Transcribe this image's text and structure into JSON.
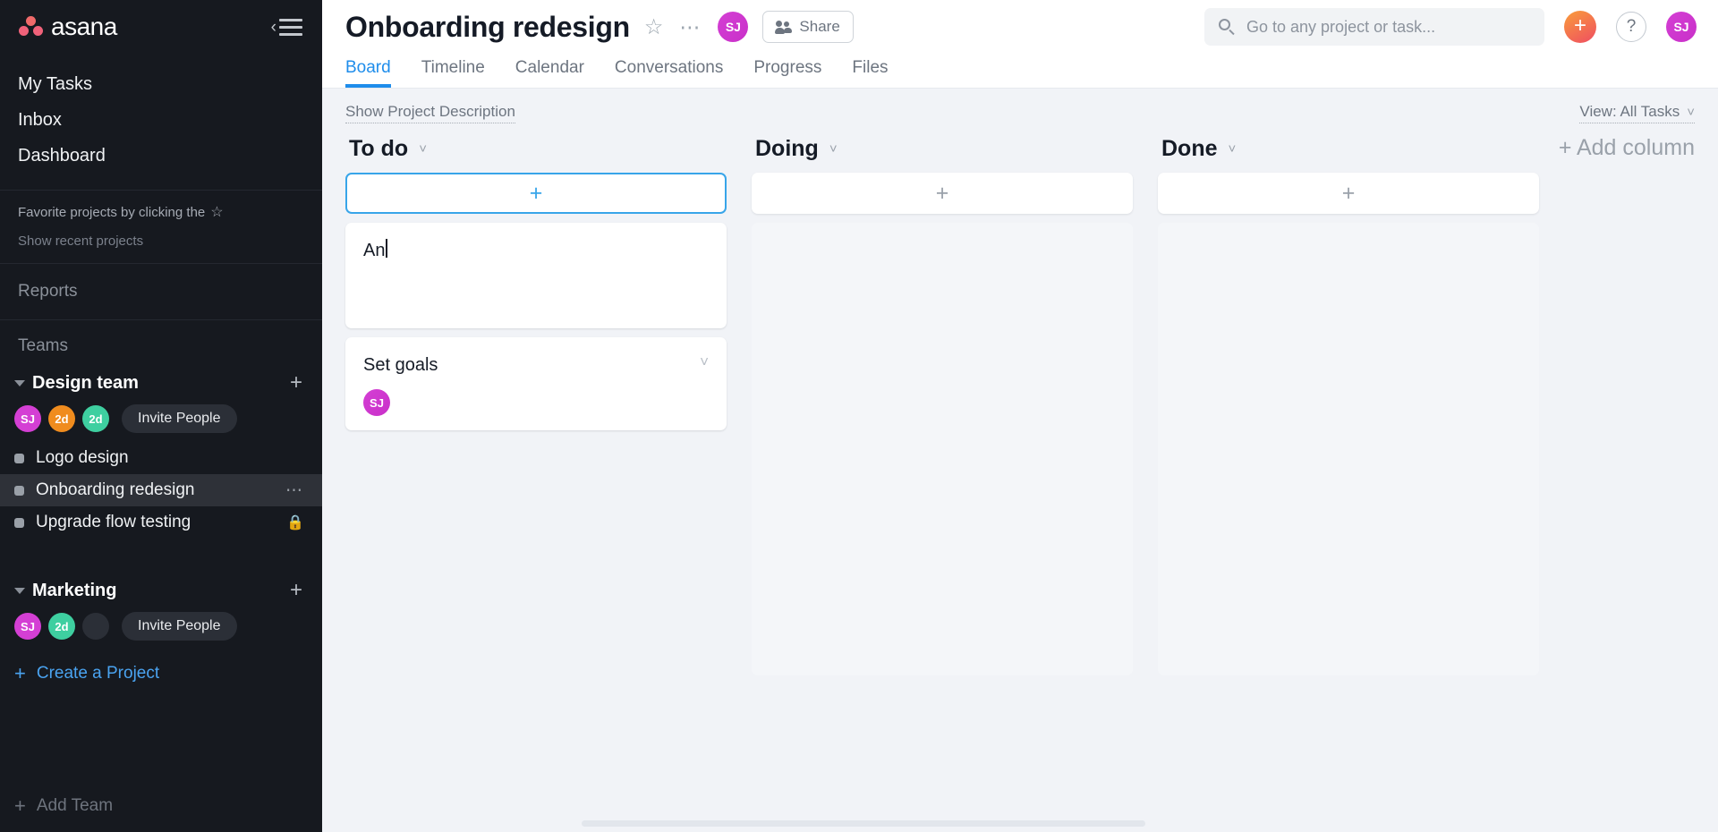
{
  "sidebar": {
    "brand": "asana",
    "collapse_icon": "collapse-sidebar-icon",
    "nav": [
      {
        "label": "My Tasks"
      },
      {
        "label": "Inbox"
      },
      {
        "label": "Dashboard"
      }
    ],
    "favorite_hint": "Favorite projects by clicking the",
    "show_recent": "Show recent projects",
    "reports_label": "Reports",
    "teams_label": "Teams",
    "teams": [
      {
        "name": "Design team",
        "members": [
          {
            "initials": "SJ",
            "color": "#d43fd4"
          },
          {
            "initials": "2d",
            "color": "#f08c1e"
          },
          {
            "initials": "2d",
            "color": "#3ecfa0"
          }
        ],
        "empty_slots": 0,
        "invite_label": "Invite People",
        "projects": [
          {
            "name": "Logo design",
            "active": false,
            "lock": false,
            "more": false
          },
          {
            "name": "Onboarding redesign",
            "active": true,
            "lock": false,
            "more": true
          },
          {
            "name": "Upgrade flow testing",
            "active": false,
            "lock": true,
            "more": false
          }
        ]
      },
      {
        "name": "Marketing",
        "members": [
          {
            "initials": "SJ",
            "color": "#d43fd4"
          },
          {
            "initials": "2d",
            "color": "#3ecfa0"
          }
        ],
        "empty_slots": 1,
        "invite_label": "Invite People",
        "projects": []
      }
    ],
    "create_project": "Create a Project",
    "add_team": "Add Team"
  },
  "header": {
    "project_title": "Onboarding redesign",
    "star_icon": "star-outline-icon",
    "more_icon": "more-options-icon",
    "avatar": {
      "initials": "SJ"
    },
    "share_label": "Share",
    "search_placeholder": "Go to any project or task...",
    "plus_label": "+",
    "help_label": "?",
    "user_avatar": {
      "initials": "SJ"
    },
    "tabs": [
      {
        "label": "Board",
        "active": true
      },
      {
        "label": "Timeline",
        "active": false
      },
      {
        "label": "Calendar",
        "active": false
      },
      {
        "label": "Conversations",
        "active": false
      },
      {
        "label": "Progress",
        "active": false
      },
      {
        "label": "Files",
        "active": false
      }
    ]
  },
  "board": {
    "show_description": "Show Project Description",
    "view_filter": "View: All Tasks",
    "add_column": "+ Add column",
    "columns": [
      {
        "title": "To do",
        "add_focused": true,
        "cards": [
          {
            "title": "An",
            "composing": true,
            "assignee": null,
            "chevron": false
          },
          {
            "title": "Set goals",
            "composing": false,
            "assignee": {
              "initials": "SJ"
            },
            "chevron": true
          }
        ]
      },
      {
        "title": "Doing",
        "add_focused": false,
        "cards": []
      },
      {
        "title": "Done",
        "add_focused": false,
        "cards": []
      }
    ]
  },
  "colors": {
    "accent_blue": "#1f8deb",
    "focus_blue": "#38a5e9",
    "sidebar_bg": "#16191f",
    "sidebar_active": "#2e3138",
    "board_bg": "#f1f3f7",
    "link_blue": "#4aa3f0"
  }
}
